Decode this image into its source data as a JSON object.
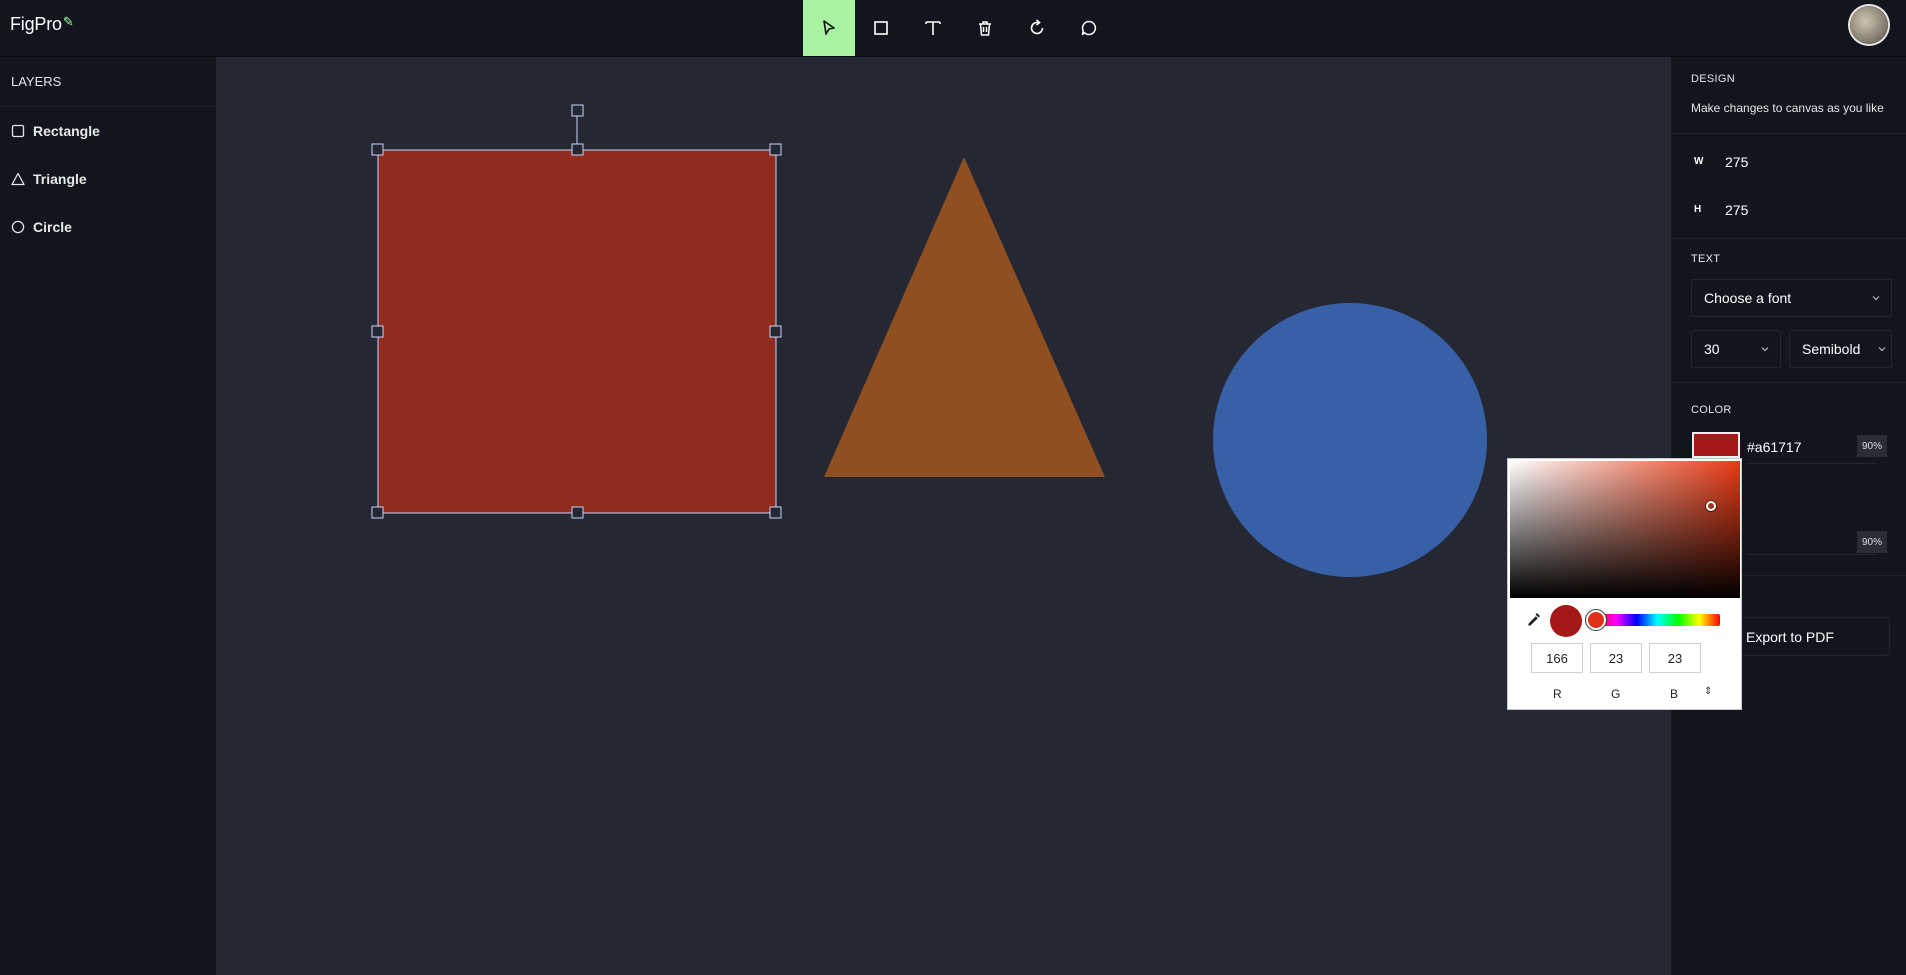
{
  "app": {
    "logo": "FigPro",
    "logo_icon": "pen-icon"
  },
  "toolbar": {
    "tools": [
      {
        "name": "select-tool",
        "icon": "cursor-icon",
        "active": true
      },
      {
        "name": "rectangle-tool",
        "icon": "square-icon"
      },
      {
        "name": "text-tool",
        "icon": "text-icon"
      },
      {
        "name": "delete-tool",
        "icon": "trash-icon"
      },
      {
        "name": "reset-tool",
        "icon": "rotate-icon"
      },
      {
        "name": "comment-tool",
        "icon": "comment-icon"
      }
    ],
    "active_color": "#a8f2a2"
  },
  "layers": {
    "title": "LAYERS",
    "items": [
      {
        "label": "Rectangle",
        "icon": "square-icon"
      },
      {
        "label": "Triangle",
        "icon": "triangle-icon"
      },
      {
        "label": "Circle",
        "icon": "circle-icon"
      }
    ]
  },
  "canvas": {
    "shapes": [
      {
        "type": "rectangle",
        "color": "#912b1e",
        "selected": true
      },
      {
        "type": "triangle",
        "color": "#8f4f20"
      },
      {
        "type": "circle",
        "color": "#3860a7"
      }
    ]
  },
  "design": {
    "title": "DESIGN",
    "subtitle": "Make changes to canvas as you like",
    "width_label": "W",
    "width": "275",
    "height_label": "H",
    "height": "275",
    "text_label": "TEXT",
    "font_placeholder": "Choose a font",
    "font_size": "30",
    "font_weight": "Semibold",
    "color_label": "COLOR",
    "color_hex": "#a61717",
    "color_opacity": "90%",
    "stroke_opacity": "90%",
    "export_label": "Export to PDF"
  },
  "color_picker": {
    "r": "166",
    "g": "23",
    "b": "23",
    "r_label": "R",
    "g_label": "G",
    "b_label": "B",
    "preview_color": "#a61717"
  }
}
